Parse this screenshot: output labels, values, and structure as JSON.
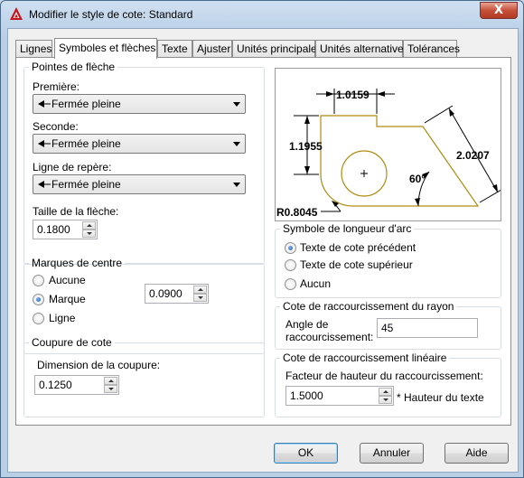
{
  "window": {
    "title": "Modifier le style de cote: Standard",
    "close_label": "X"
  },
  "tabs": [
    {
      "label": "Lignes"
    },
    {
      "label": "Symboles et flèches",
      "active": true
    },
    {
      "label": "Texte"
    },
    {
      "label": "Ajuster"
    },
    {
      "label": "Unités principales"
    },
    {
      "label": "Unités alternatives"
    },
    {
      "label": "Tolérances"
    }
  ],
  "arrowheads": {
    "legend": "Pointes de flèche",
    "first_label": "Première:",
    "first_value": "Fermée pleine",
    "second_label": "Seconde:",
    "second_value": "Fermée pleine",
    "leader_label": "Ligne de repère:",
    "leader_value": "Fermée pleine",
    "size_label": "Taille de la flèche:",
    "size_value": "0.1800"
  },
  "center_marks": {
    "legend": "Marques de centre",
    "options": [
      "Aucune",
      "Marque",
      "Ligne"
    ],
    "selected": "Marque",
    "size_value": "0.0900"
  },
  "dim_break": {
    "legend": "Coupure de cote",
    "size_label": "Dimension de la coupure:",
    "size_value": "0.1250"
  },
  "preview": {
    "dim_top": "1.0159",
    "dim_left": "1.1955",
    "dim_right": "2.0207",
    "angle": "60°",
    "radius": "R0.8045",
    "line_color": "#000000",
    "shape_color": "#b08a10"
  },
  "arc_length": {
    "legend": "Symbole de longueur d'arc",
    "options": [
      "Texte de cote précédent",
      "Texte de cote supérieur",
      "Aucun"
    ],
    "selected": "Texte de cote précédent"
  },
  "radius_jog": {
    "legend": "Cote de raccourcissement du rayon",
    "angle_label_1": "Angle de",
    "angle_label_2": "raccourcissement:",
    "angle_value": "45"
  },
  "linear_jog": {
    "legend": "Cote de raccourcissement linéaire",
    "factor_label": "Facteur de hauteur du raccourcissement:",
    "factor_value": "1.5000",
    "factor_suffix": "* Hauteur du texte"
  },
  "buttons": {
    "ok": "OK",
    "cancel": "Annuler",
    "help": "Aide"
  },
  "colors": {
    "accent": "#3c7fb1",
    "close_red": "#c7503a"
  }
}
